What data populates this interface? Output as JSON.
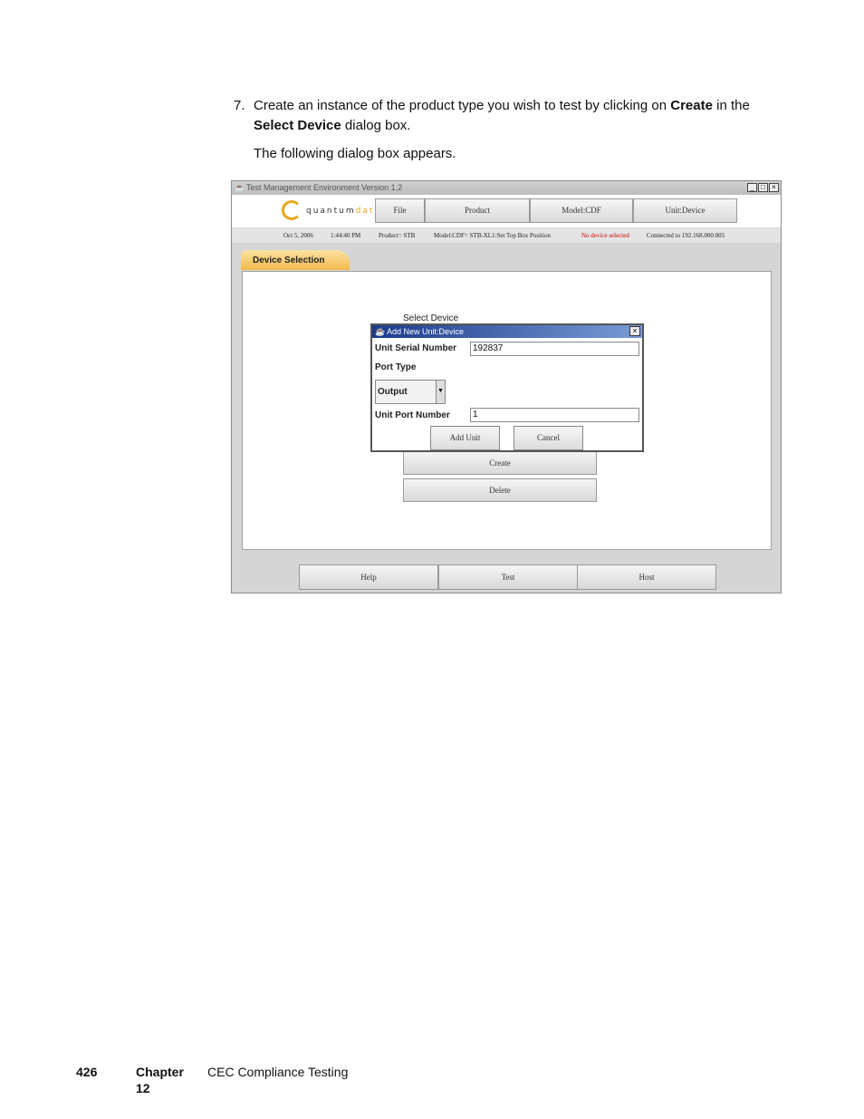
{
  "instruction": {
    "number": "7.",
    "text_before": "Create an instance of the product type you wish to test by clicking on ",
    "bold1": "Create",
    "text_middle": " in the ",
    "bold2": "Select Device",
    "text_after": " dialog box.",
    "follow": "The following dialog box appears."
  },
  "window": {
    "title": "Test Management Environment Version 1.2",
    "controls": [
      "_",
      "□",
      "×"
    ]
  },
  "logo": {
    "word1": "quantum",
    "word2": "data"
  },
  "toolbar": {
    "buttons": [
      "File",
      "Product",
      "Model:CDF",
      "Unit:Device"
    ]
  },
  "status": {
    "date": "Oct 5, 2006",
    "time": "1:44:40 PM",
    "product": "Product= STB",
    "model": "Model:CDF= STB-XL1:Set Top Box Position",
    "device": "No device selected",
    "connection": "Connected to 192.168.000.005"
  },
  "panel": {
    "tab_label": "Device Selection",
    "select_title": "Select Device",
    "create_label": "Create",
    "delete_label": "Delete"
  },
  "bottom_buttons": [
    "Help",
    "Test",
    "Host"
  ],
  "dialog": {
    "title": "Add New Unit:Device",
    "serial_label": "Unit Serial Number",
    "serial_value": "192837",
    "port_type_label": "Port Type",
    "port_type_value": "Output",
    "port_number_label": "Unit Port Number",
    "port_number_value": "1",
    "add_label": "Add Unit",
    "cancel_label": "Cancel"
  },
  "footer": {
    "page": "426",
    "chapter": "Chapter 12",
    "chapter_title": "CEC Compliance Testing"
  },
  "colors": {
    "tab_orange": "#f2b94c",
    "status_red": "#d00000",
    "dialog_title_blue": "#1a3a8a",
    "logo_gold": "#e8a81a"
  }
}
